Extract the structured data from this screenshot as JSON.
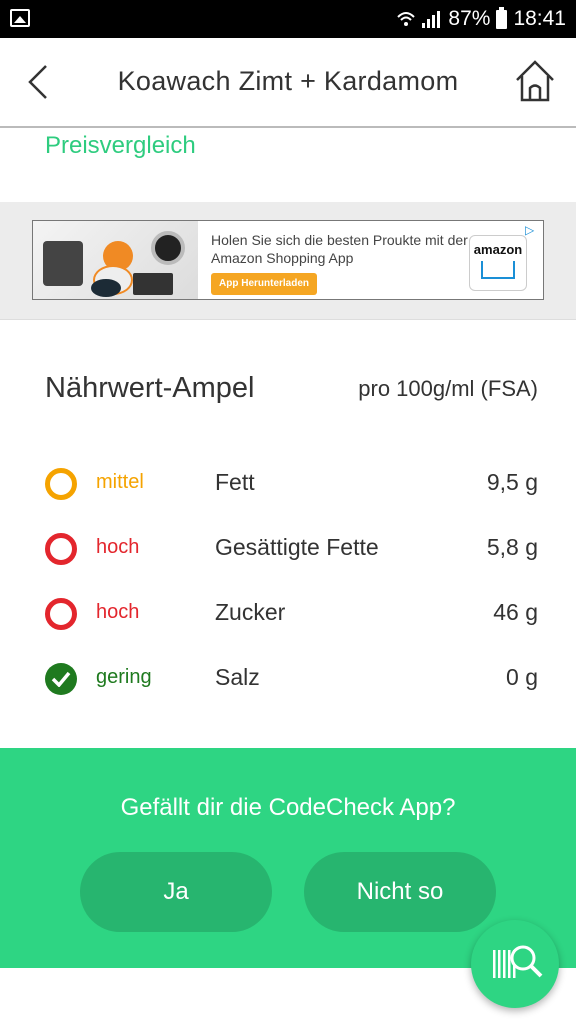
{
  "status_bar": {
    "battery": "87%",
    "time": "18:41"
  },
  "header": {
    "title": "Koawach Zimt + Kardamom"
  },
  "preisvergleich_link": "Preisvergleich",
  "ad": {
    "text": "Holen Sie sich die besten Proukte mit der Amazon Shopping App",
    "cta": "App Herunterladen",
    "brand": "amazon"
  },
  "nutrition": {
    "heading": "Nährwert-Ampel",
    "per": "pro 100g/ml (FSA)",
    "rows": [
      {
        "level": "mittel",
        "name": "Fett",
        "value": "9,5 g",
        "color": "#f5a300"
      },
      {
        "level": "hoch",
        "name": "Gesättigte Fette",
        "value": "5,8 g",
        "color": "#e3262d"
      },
      {
        "level": "hoch",
        "name": "Zucker",
        "value": "46 g",
        "color": "#e3262d"
      },
      {
        "level": "gering",
        "name": "Salz",
        "value": "0 g",
        "color": "#1f7a1f"
      }
    ]
  },
  "feedback": {
    "question": "Gefällt dir die CodeCheck App?",
    "yes_label": "Ja",
    "no_label": "Nicht so"
  },
  "colors": {
    "accent": "#2ed583",
    "link": "#2ecc7f"
  }
}
